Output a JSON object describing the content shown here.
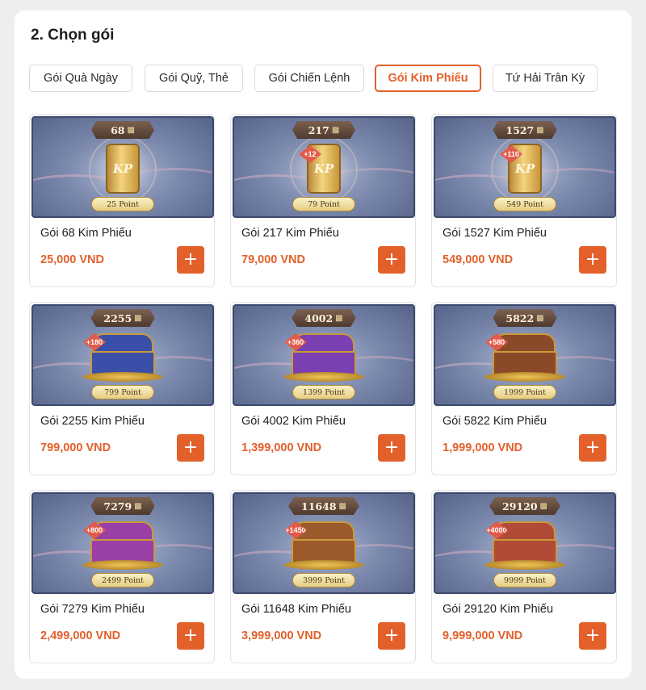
{
  "section": {
    "title": "2. Chọn gói"
  },
  "tabs": [
    {
      "label": "Gói Quà Ngày",
      "active": false
    },
    {
      "label": "Gói Quỹ, Thẻ",
      "active": false
    },
    {
      "label": "Gói Chiến Lệnh",
      "active": false
    },
    {
      "label": "Gói Kim Phiếu",
      "active": true
    },
    {
      "label": "Tứ Hải Trân Kỳ",
      "active": false
    }
  ],
  "packages": [
    {
      "amount": "68",
      "bonus": "",
      "points": "25 Point",
      "name": "Gói 68 Kim Phiếu",
      "price": "25,000 VND",
      "art": "scroll-icon",
      "scroll_text": "KP",
      "add_label": "+"
    },
    {
      "amount": "217",
      "bonus": "+12",
      "points": "79 Point",
      "name": "Gói 217 Kim Phiếu",
      "price": "79,000 VND",
      "art": "scroll-icon",
      "scroll_text": "KP",
      "add_label": "+"
    },
    {
      "amount": "1527",
      "bonus": "+110",
      "points": "549 Point",
      "name": "Gói 1527 Kim Phiếu",
      "price": "549,000 VND",
      "art": "scroll-icon",
      "scroll_text": "KP",
      "add_label": "+"
    },
    {
      "amount": "2255",
      "bonus": "+180",
      "points": "799 Point",
      "name": "Gói 2255 Kim Phiếu",
      "price": "799,000 VND",
      "art": "chest-icon",
      "chest_color": "#3b4fa8",
      "add_label": "+"
    },
    {
      "amount": "4002",
      "bonus": "+360",
      "points": "1399 Point",
      "name": "Gói 4002 Kim Phiếu",
      "price": "1,399,000 VND",
      "art": "chest-icon",
      "chest_color": "#7a3fb0",
      "add_label": "+"
    },
    {
      "amount": "5822",
      "bonus": "+580",
      "points": "1999 Point",
      "name": "Gói 5822 Kim Phiếu",
      "price": "1,999,000 VND",
      "art": "chest-icon",
      "chest_color": "#8a4a2a",
      "add_label": "+"
    },
    {
      "amount": "7279",
      "bonus": "+800",
      "points": "2499 Point",
      "name": "Gói 7279 Kim Phiếu",
      "price": "2,499,000 VND",
      "art": "chest-icon",
      "chest_color": "#9a3fa6",
      "add_label": "+"
    },
    {
      "amount": "11648",
      "bonus": "+1450",
      "points": "3999 Point",
      "name": "Gói 11648 Kim Phiếu",
      "price": "3,999,000 VND",
      "art": "chest-icon",
      "chest_color": "#9c5a2c",
      "add_label": "+"
    },
    {
      "amount": "29120",
      "bonus": "+4000",
      "points": "9999 Point",
      "name": "Gói 29120 Kim Phiếu",
      "price": "9,999,000 VND",
      "art": "chest-icon",
      "chest_color": "#b24a38",
      "add_label": "+"
    }
  ],
  "colors": {
    "accent": "#e3602b",
    "coin_icon": "coin-icon"
  }
}
